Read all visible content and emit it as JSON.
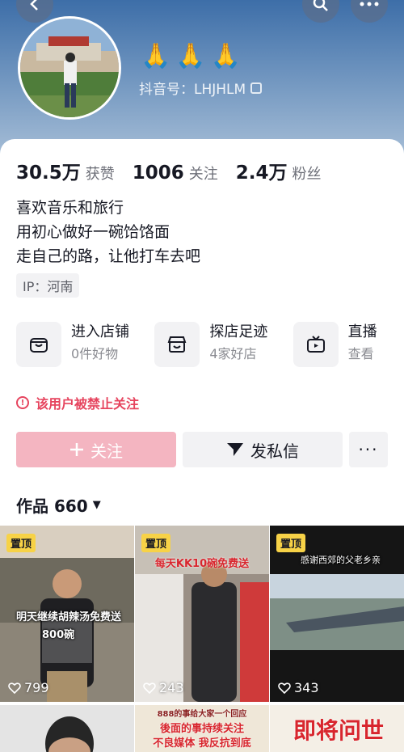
{
  "profile": {
    "nickname": "🙏🙏🙏",
    "douyin_id": "抖音号：LHJHLM"
  },
  "stats": [
    {
      "num": "30.5万",
      "label": "获赞"
    },
    {
      "num": "1006",
      "label": "关注"
    },
    {
      "num": "2.4万",
      "label": "粉丝"
    }
  ],
  "bio": {
    "line1": "喜欢音乐和旅行",
    "line2": "用初心做好一碗饸饹面",
    "line3": "走自己的路，让他打车去吧"
  },
  "ip": "IP：河南",
  "services": [
    {
      "title": "进入店铺",
      "sub": "0件好物",
      "icon": "shop-icon"
    },
    {
      "title": "探店足迹",
      "sub": "4家好店",
      "icon": "store-visit-icon"
    },
    {
      "title": "直播",
      "sub": "查看",
      "icon": "tv-icon"
    }
  ],
  "notice": "该用户被禁止关注",
  "actions": {
    "follow": "关注",
    "message": "发私信",
    "more": "···"
  },
  "works": {
    "label": "作品 660"
  },
  "videos": [
    {
      "pinned": "置顶",
      "likes": "799",
      "caption": "明天继续胡辣汤免费送",
      "caption2": "800碗"
    },
    {
      "pinned": "置顶",
      "likes": "243",
      "caption": "每天KK10碗免费送"
    },
    {
      "pinned": "置顶",
      "likes": "343",
      "caption": "感谢西郊的父老乡亲"
    },
    {
      "caption": "888的事给大家一个回应",
      "caption2": "後面的事持续关注",
      "caption3": "不良媒体 我反抗到底"
    },
    {
      "caption": "即将问世"
    }
  ],
  "colors": {
    "accent_pink": "#f4b5c1",
    "warning_red": "#e6445e",
    "pin_yellow": "#f7d247"
  }
}
